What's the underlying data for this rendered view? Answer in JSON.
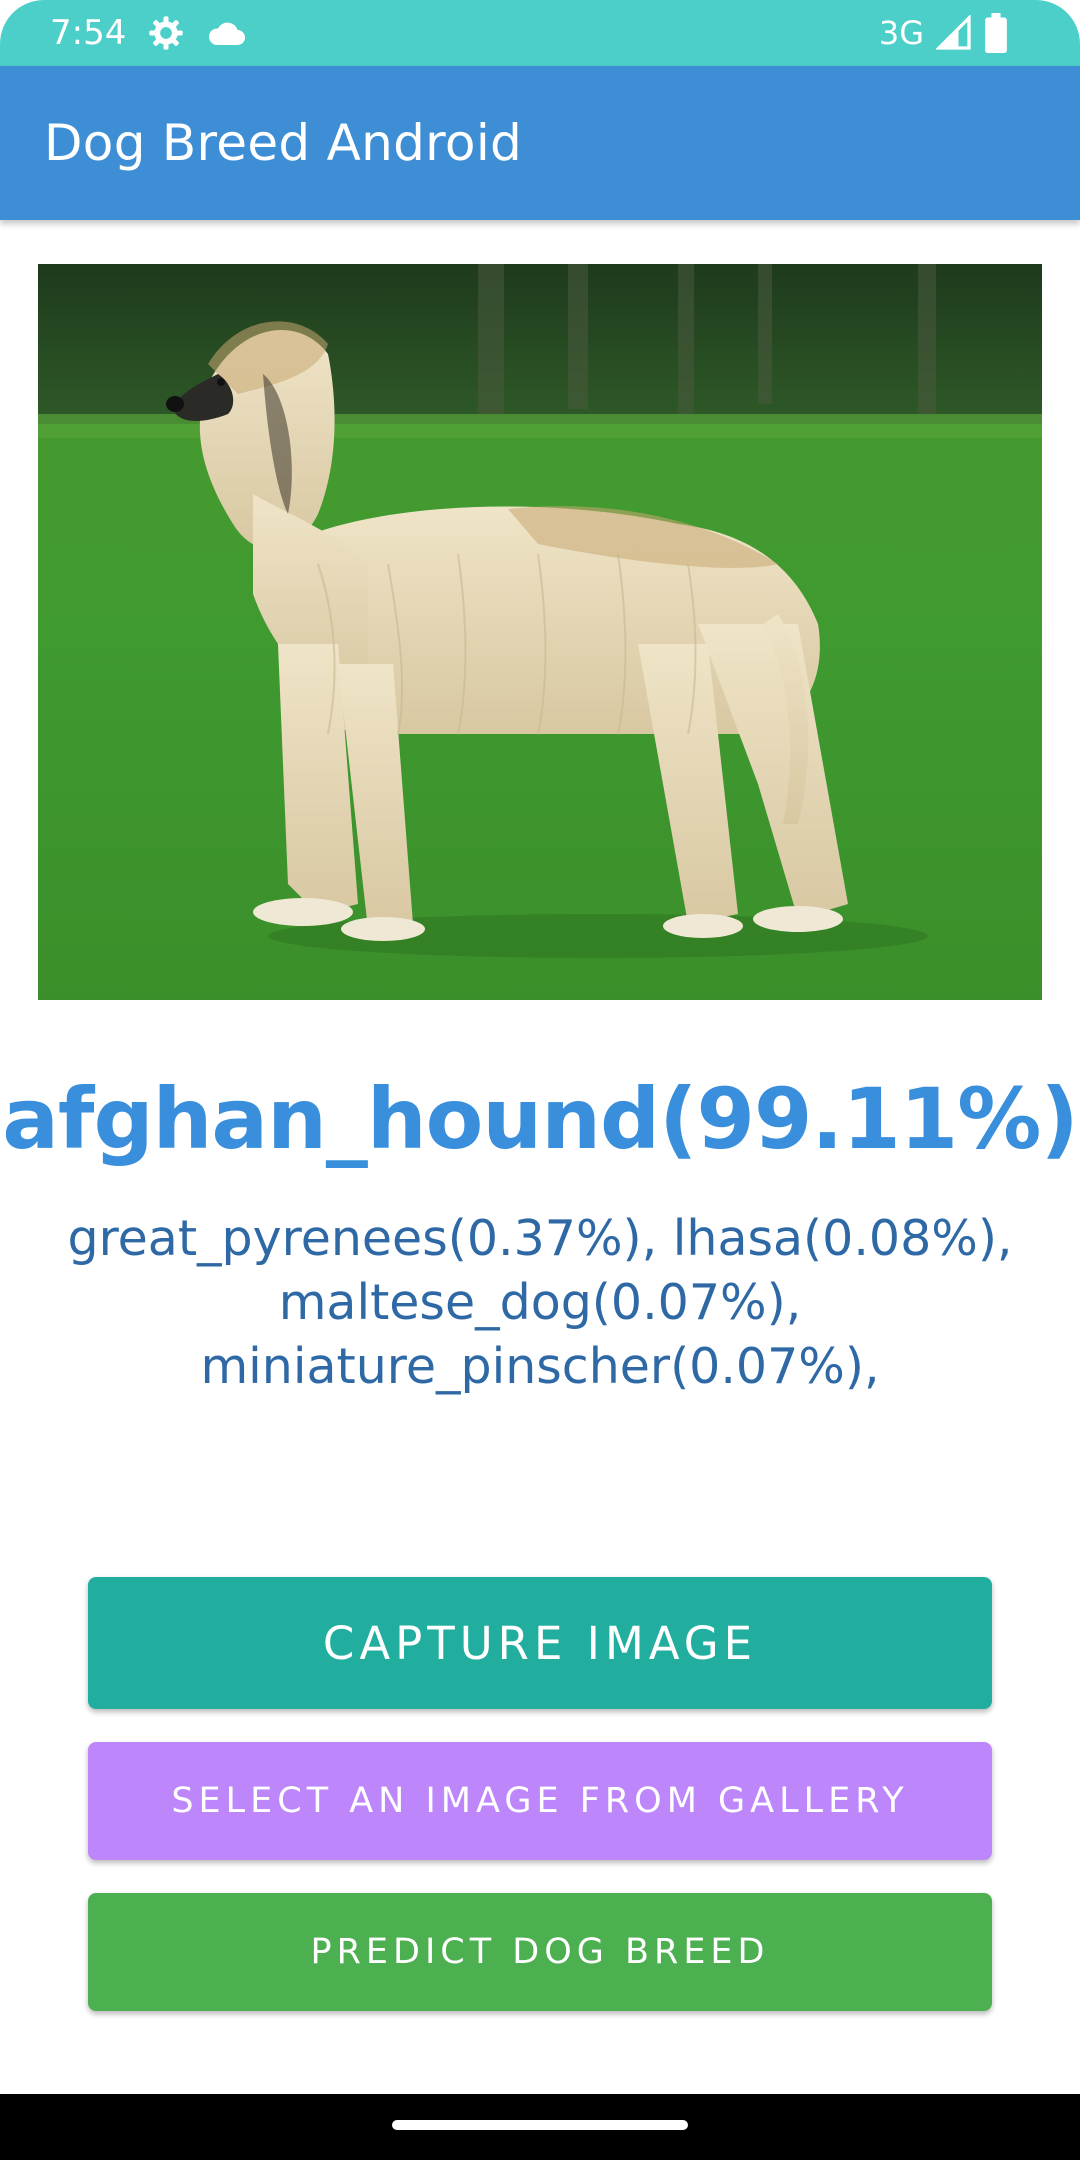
{
  "status_bar": {
    "time": "7:54",
    "network": "3G",
    "icons": [
      "gear-icon",
      "cloud-icon",
      "signal-icon",
      "battery-icon"
    ],
    "color": "#4bcfc8"
  },
  "app_bar": {
    "title": "Dog Breed Android",
    "color": "#3d8ed4"
  },
  "image": {
    "subject": "dog-photo"
  },
  "prediction": {
    "top": "afghan_hound(99.11%)",
    "others": "great_pyrenees(0.37%), lhasa(0.08%), maltese_dog(0.07%), miniature_pinscher(0.07%),"
  },
  "buttons": {
    "capture": "CAPTURE IMAGE",
    "gallery": "SELECT AN IMAGE FROM GALLERY",
    "predict": "PREDICT DOG BREED"
  },
  "colors": {
    "capture": "#22ae9f",
    "gallery": "#bd86fa",
    "predict": "#4caf50",
    "prediction_text": "#3a8fdc"
  }
}
